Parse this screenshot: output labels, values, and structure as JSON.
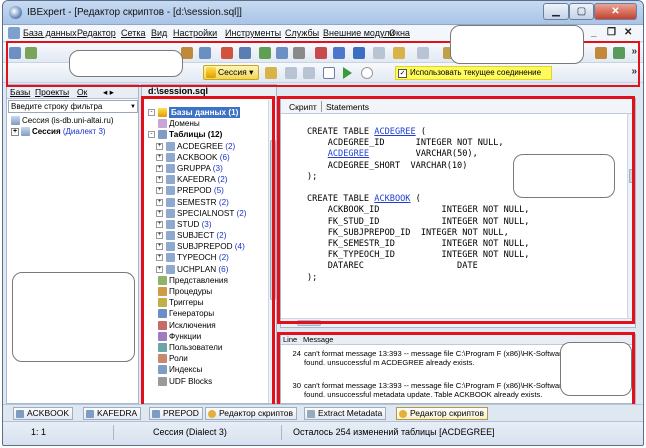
{
  "window": {
    "title": "IBExpert - [Редактор скриптов - [d:\\session.sql]]"
  },
  "menu": [
    "База данных",
    "Редактор",
    "Сетка",
    "Вид",
    "Настройки",
    "Инструменты",
    "Службы",
    "Внешние модули",
    "Окна"
  ],
  "toolbar": {
    "session_label": "Сессия",
    "use_current_connection": "Использовать текущее соединение",
    "use_current_connection_checked": true
  },
  "left_panel": {
    "tabs": [
      "Базы",
      "Проекты",
      "Ок"
    ],
    "filter_placeholder": "Введите строку фильтра",
    "connections": [
      {
        "name": "Сессия (is-db.uni-altai.ru)",
        "suffix": ""
      },
      {
        "name": "Сессия",
        "suffix": "(Диалект 3)"
      }
    ]
  },
  "tree_panel": {
    "file": "d:\\session.sql",
    "root": "Базы данных (1)",
    "domains": "Домены",
    "tables_group": "Таблицы (12)",
    "tables": [
      {
        "name": "ACDEGREE",
        "count": "(2)"
      },
      {
        "name": "ACKBOOK",
        "count": "(6)"
      },
      {
        "name": "GRUPPA",
        "count": "(3)"
      },
      {
        "name": "KAFEDRA",
        "count": "(2)"
      },
      {
        "name": "PREPOD",
        "count": "(5)"
      },
      {
        "name": "SEMESTR",
        "count": "(2)"
      },
      {
        "name": "SPECIALNOST",
        "count": "(2)"
      },
      {
        "name": "STUD",
        "count": "(3)"
      },
      {
        "name": "SUBJECT",
        "count": "(2)"
      },
      {
        "name": "SUBJPREPOD",
        "count": "(4)"
      },
      {
        "name": "TYPEOCH",
        "count": "(2)"
      },
      {
        "name": "UCHPLAN",
        "count": "(6)"
      }
    ],
    "other_nodes": [
      "Представления",
      "Процедуры",
      "Триггеры",
      "Генераторы",
      "Исключения",
      "Функции",
      "Пользователи",
      "Роли",
      "Индексы",
      "UDF Blocks"
    ]
  },
  "editor": {
    "tabs": [
      "Скрипт",
      "Statements"
    ],
    "code_lines": [
      [
        {
          "t": "CREATE TABLE "
        },
        {
          "t": "ACDEGREE",
          "u": true
        },
        {
          "t": " ("
        }
      ],
      [
        {
          "t": "    ACDEGREE_ID      INTEGER NOT NULL,"
        }
      ],
      [
        {
          "t": "    "
        },
        {
          "t": "ACDEGREE",
          "u": true
        },
        {
          "t": "         VARCHAR(50),"
        }
      ],
      [
        {
          "t": "    ACDEGREE_SHORT  VARCHAR(10)"
        }
      ],
      [
        {
          "t": ");"
        }
      ],
      [
        {
          "t": ""
        }
      ],
      [
        {
          "t": "CREATE TABLE "
        },
        {
          "t": "ACKBOOK",
          "u": true
        },
        {
          "t": " ("
        }
      ],
      [
        {
          "t": "    ACKBOOK_ID            INTEGER NOT NULL,"
        }
      ],
      [
        {
          "t": "    FK_STUD_ID            INTEGER NOT NULL,"
        }
      ],
      [
        {
          "t": "    FK_SUBJPREPOD_ID  INTEGER NOT NULL,"
        }
      ],
      [
        {
          "t": "    FK_SEMESTR_ID         INTEGER NOT NULL,"
        }
      ],
      [
        {
          "t": "    FK_TYPEOCH_ID         INTEGER NOT NULL,"
        }
      ],
      [
        {
          "t": "    DATAREC                  DATE"
        }
      ],
      [
        {
          "t": ");"
        }
      ]
    ]
  },
  "messages": {
    "columns": [
      "Line",
      "Message"
    ],
    "rows": [
      {
        "line": "24",
        "text": "can't format message 13:393 -- message file C:\\Program F (x86)\\HK-Software\\firebird.msg not found. unsuccessful m ACDEGREE already exists."
      },
      {
        "line": "30",
        "text": "can't format message 13:393 -- message file C:\\Program F (x86)\\HK-Software\\firebird.msg not found. unsuccessful metadata update. Table ACKBOOK already exists."
      }
    ]
  },
  "doc_tabs": [
    "ACKBOOK",
    "KAFEDRA",
    "PREPOD",
    "Редактор скриптов",
    "Extract Metadata",
    "Редактор скриптов"
  ],
  "status": {
    "pos": "1:    1",
    "session": "Сессия (Dialect 3)",
    "changes": "Осталось 254 изменений таблицы [ACDEGREE]"
  },
  "colors": {
    "accent": "#1b33c9",
    "highlight": "#e0111b",
    "selection": "#3e72c4"
  }
}
